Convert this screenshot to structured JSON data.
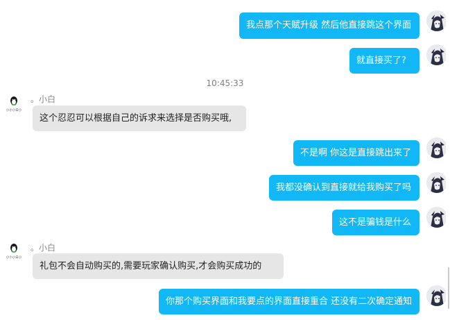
{
  "window": {
    "title": ""
  },
  "timestamp": "10:45:33",
  "contact": {
    "nickname": "。小白",
    "avatar_caption": "小小小白小"
  },
  "messages": [
    {
      "dir": "out",
      "text": "我点那个天赋升级 然后他直接跳这个界面"
    },
    {
      "dir": "out",
      "text": "就直接买了?"
    },
    {
      "dir": "in",
      "text": "这个忍忍可以根据自己的诉求来选择是否购买哦,"
    },
    {
      "dir": "out",
      "text": "不是啊 你这是直接跳出来了"
    },
    {
      "dir": "out",
      "text": "我都没确认到直接就给我购买了吗"
    },
    {
      "dir": "out",
      "text": "这不是骗钱是什么"
    },
    {
      "dir": "in",
      "text": "礼包不会自动购买的,需要玩家确认购买,才会购买成功的"
    },
    {
      "dir": "out",
      "text": "你那个购买界面和我要点的界面直接重合 还没有二次确定通知"
    }
  ],
  "colors": {
    "outgoing_bubble": "#12b7f5",
    "incoming_bubble": "#e6e6e6",
    "background": "#ffffff"
  },
  "icons": {
    "self_avatar": "anime-character-avatar-icon",
    "contact_avatar": "penguin-avatar-icon"
  }
}
